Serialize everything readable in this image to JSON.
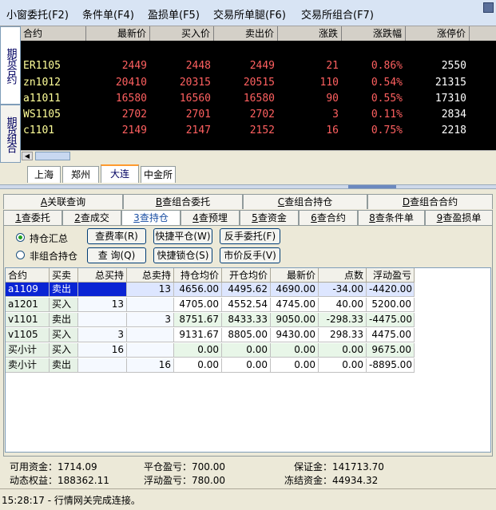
{
  "menu": {
    "items": [
      "小窗委托(F2)",
      "条件单(F4)",
      "盈损单(F5)",
      "交易所单腿(F6)",
      "交易所组合(F7)"
    ]
  },
  "side_tabs": {
    "futures_contract": "期货合约",
    "futures_combo": "期货组合"
  },
  "quote": {
    "headers": [
      "合约",
      "最新价",
      "买入价",
      "卖出价",
      "涨跌",
      "涨跌幅",
      "涨停价"
    ],
    "rows": [
      {
        "contract": "ER1105",
        "last": "2449",
        "bid": "2448",
        "ask": "2449",
        "change": "21",
        "change_pct": "0.86%",
        "limit_up": "2550"
      },
      {
        "contract": "zn1012",
        "last": "20410",
        "bid": "20315",
        "ask": "20515",
        "change": "110",
        "change_pct": "0.54%",
        "limit_up": "21315"
      },
      {
        "contract": "a11011",
        "last": "16580",
        "bid": "16560",
        "ask": "16580",
        "change": "90",
        "change_pct": "0.55%",
        "limit_up": "17310"
      },
      {
        "contract": "WS1105",
        "last": "2702",
        "bid": "2701",
        "ask": "2702",
        "change": "3",
        "change_pct": "0.11%",
        "limit_up": "2834"
      },
      {
        "contract": "c1101",
        "last": "2149",
        "bid": "2147",
        "ask": "2152",
        "change": "16",
        "change_pct": "0.75%",
        "limit_up": "2218"
      }
    ],
    "colors": {
      "contract": "#ffff99",
      "price": "#ff6060",
      "limit_up": "#ffffff"
    }
  },
  "exchange_tabs": [
    "上海",
    "郑州",
    "大连",
    "中金所"
  ],
  "query_tabs": [
    {
      "hot": "A",
      "rest": "关联查询"
    },
    {
      "hot": "B",
      "rest": "查组合委托"
    },
    {
      "hot": "C",
      "rest": "查组合持仓"
    },
    {
      "hot": "D",
      "rest": "查组合合约"
    }
  ],
  "main_tabs": [
    {
      "hot": "1",
      "rest": "查委托"
    },
    {
      "hot": "2",
      "rest": "查成交"
    },
    {
      "hot": "3",
      "rest": "查持仓"
    },
    {
      "hot": "4",
      "rest": "查预埋"
    },
    {
      "hot": "5",
      "rest": "查资金"
    },
    {
      "hot": "6",
      "rest": "查合约"
    },
    {
      "hot": "8",
      "rest": "查条件单"
    },
    {
      "hot": "9",
      "rest": "查盈损单"
    }
  ],
  "options": {
    "summary": "持仓汇总",
    "non_combo": "非组合持仓"
  },
  "buttons": {
    "fee_rate": "查费率(R)",
    "quick_close": "快捷平仓(W)",
    "reverse_order": "反手委托(F)",
    "query": "查 询(Q)",
    "quick_lock": "快捷锁仓(S)",
    "market_reverse": "市价反手(V)"
  },
  "positions": {
    "headers": [
      "合约",
      "买卖",
      "总买持",
      "总卖持",
      "持仓均价",
      "开仓均价",
      "最新价",
      "点数",
      "浮动盈亏"
    ],
    "rows": [
      {
        "contract": "a1109",
        "side": "卖出",
        "buy": "",
        "sell": "13",
        "hold_avg": "4656.00",
        "open_avg": "4495.62",
        "last": "4690.00",
        "points": "-34.00",
        "float_pl": "-4420.00",
        "selected": true
      },
      {
        "contract": "a1201",
        "side": "买入",
        "buy": "13",
        "sell": "",
        "hold_avg": "4705.00",
        "open_avg": "4552.54",
        "last": "4745.00",
        "points": "40.00",
        "float_pl": "5200.00"
      },
      {
        "contract": "v1101",
        "side": "卖出",
        "buy": "",
        "sell": "3",
        "hold_avg": "8751.67",
        "open_avg": "8433.33",
        "last": "9050.00",
        "points": "-298.33",
        "float_pl": "-4475.00"
      },
      {
        "contract": "v1105",
        "side": "买入",
        "buy": "3",
        "sell": "",
        "hold_avg": "9131.67",
        "open_avg": "8805.00",
        "last": "9430.00",
        "points": "298.33",
        "float_pl": "4475.00"
      },
      {
        "contract": "买小计",
        "side": "买入",
        "buy": "16",
        "sell": "",
        "hold_avg": "0.00",
        "open_avg": "0.00",
        "last": "0.00",
        "points": "0.00",
        "float_pl": "9675.00"
      },
      {
        "contract": "卖小计",
        "side": "卖出",
        "buy": "",
        "sell": "16",
        "hold_avg": "0.00",
        "open_avg": "0.00",
        "last": "0.00",
        "points": "0.00",
        "float_pl": "-8895.00"
      }
    ]
  },
  "footer": {
    "available": "可用资金：1714.09",
    "dynamic": "动态权益：188362.11",
    "close_pl": "平仓盈亏：700.00",
    "float_pl": "浮动盈亏：780.00",
    "margin": "保证金：141713.70",
    "frozen": "冻结资金：44934.32"
  },
  "status": "15:28:17 - 行情网关完成连接。"
}
